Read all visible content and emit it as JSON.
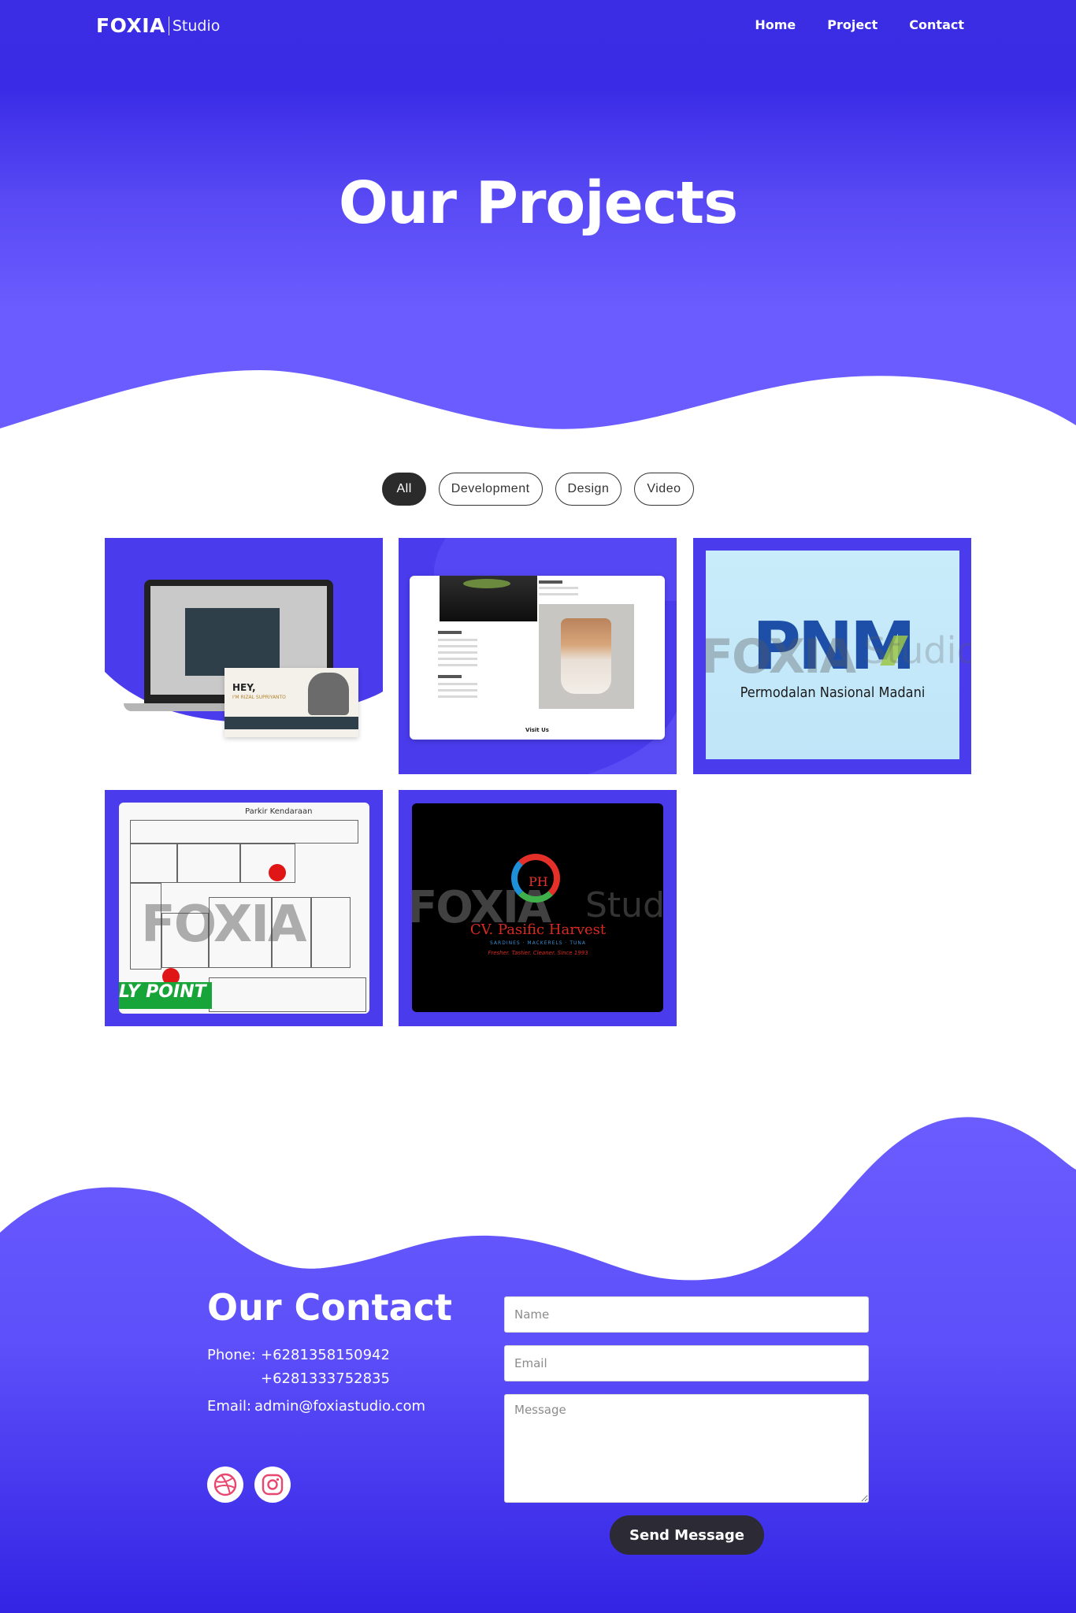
{
  "brand": {
    "name": "FOXIA",
    "suffix": "Studio"
  },
  "nav": {
    "items": [
      "Home",
      "Project",
      "Contact"
    ]
  },
  "hero": {
    "title": "Our Projects"
  },
  "filters": {
    "items": [
      "All",
      "Development",
      "Design",
      "Video"
    ],
    "selected": "All"
  },
  "projects": {
    "card1": {
      "greeting": "HEY,",
      "subtitle": "I'M RIZAL SUPRIYANTO"
    },
    "card2": {
      "footer": "Visit Us"
    },
    "card3": {
      "logo": "PNM",
      "company": "Permodalan Nasional Madani",
      "watermark": "FOXIA",
      "watermark_suffix": "Studio"
    },
    "card4": {
      "heading": "Parkir Kendaraan",
      "label": "LY POINT",
      "watermark": "FOXIA"
    },
    "card5": {
      "mark": "PH",
      "company": "CV. Pasific Harvest",
      "tagline": "SARDINES · MACKERELS · TUNA",
      "slogan": "Fresher. Tastier. Cleaner. Since 1993",
      "watermark": "FOXIA",
      "watermark_suffix": "Stud"
    }
  },
  "contact": {
    "title": "Our Contact",
    "phone_label": "Phone:",
    "phones": [
      "+6281358150942",
      "+6281333752835"
    ],
    "email_label": "Email:",
    "email": "admin@foxiastudio.com",
    "form": {
      "name_placeholder": "Name",
      "email_placeholder": "Email",
      "message_placeholder": "Message",
      "submit_label": "Send Message"
    },
    "socials": [
      "dribbble-icon",
      "instagram-icon"
    ]
  },
  "colors": {
    "primary": "#3b2de3",
    "accent": "#6a5cfe",
    "card_bg": "#4a3ced",
    "dark": "#2b2a35",
    "social_icon": "#e8466e"
  }
}
